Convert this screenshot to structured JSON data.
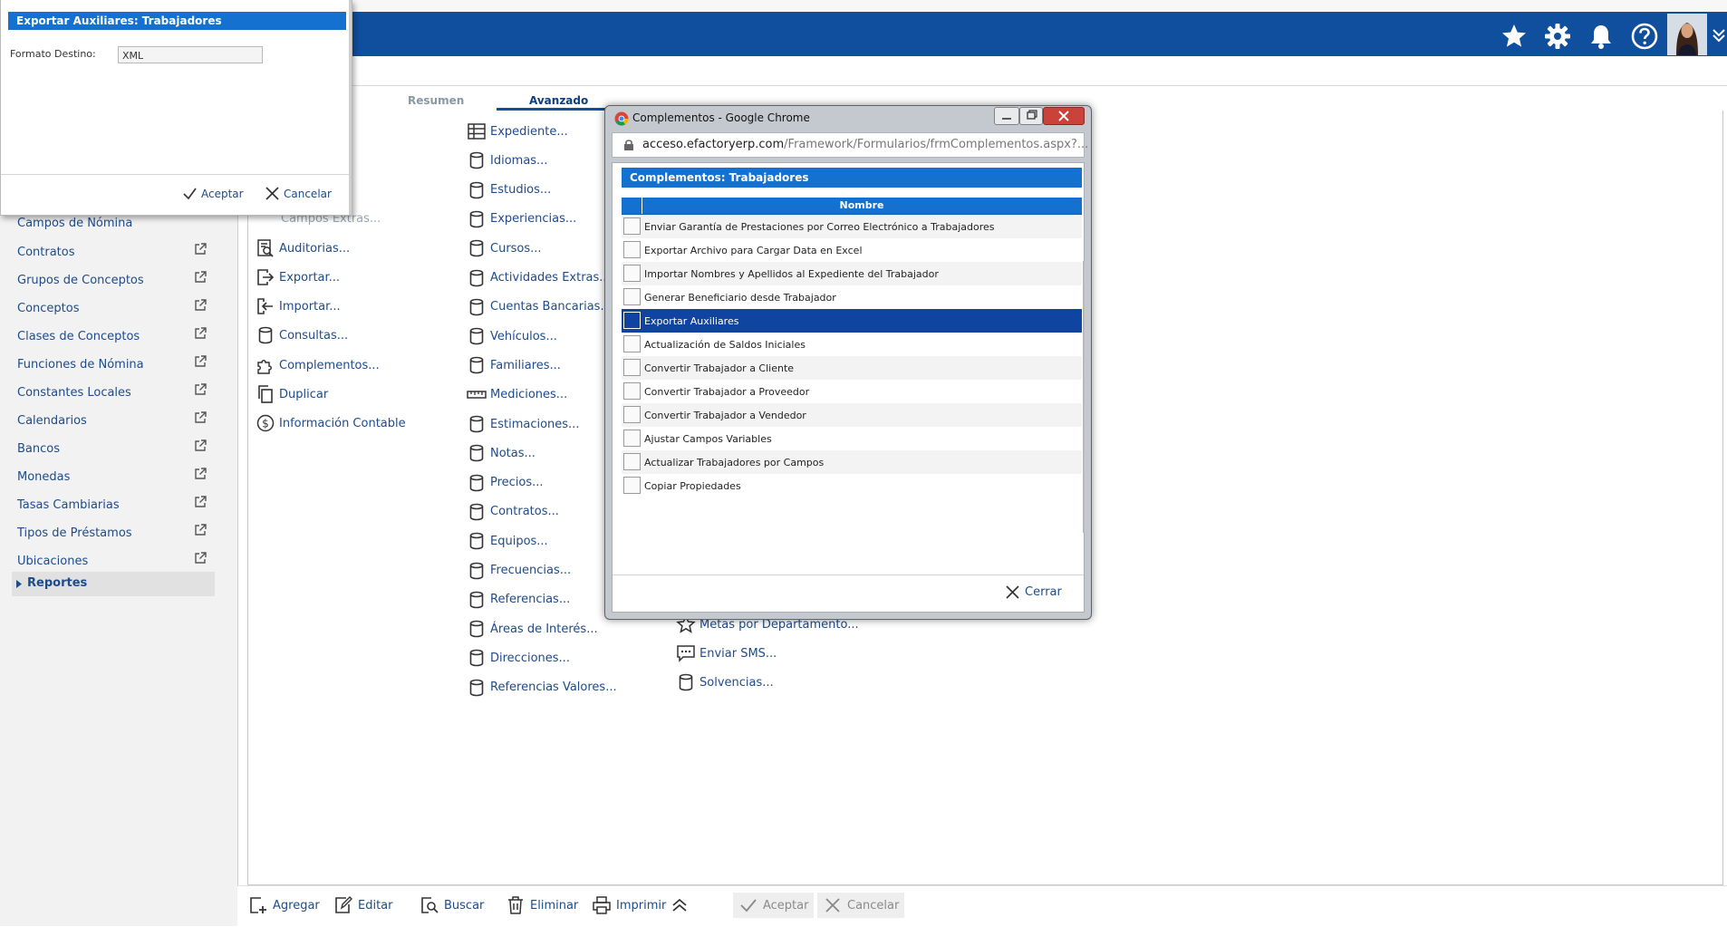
{
  "colors": {
    "header": "#0f4f9e",
    "accent": "#1571d0",
    "selected_row": "#0f44a0",
    "link": "#1e4b89"
  },
  "tabs": [
    {
      "label": "Resumen"
    },
    {
      "label": "Avanzado"
    }
  ],
  "sidebar": {
    "partial_item": "Campos de Nómina",
    "items": [
      {
        "label": "Contratos"
      },
      {
        "label": "Grupos de Conceptos"
      },
      {
        "label": "Conceptos"
      },
      {
        "label": "Clases de Conceptos"
      },
      {
        "label": "Funciones de Nómina"
      },
      {
        "label": "Constantes Locales"
      },
      {
        "label": "Calendarios"
      },
      {
        "label": "Bancos"
      },
      {
        "label": "Monedas"
      },
      {
        "label": "Tasas Cambiarias"
      },
      {
        "label": "Tipos de Préstamos"
      },
      {
        "label": "Ubicaciones"
      }
    ],
    "reports": "Reportes"
  },
  "menu_col1": {
    "partial_item": "Campos Extras...",
    "items": [
      {
        "label": "Auditorias...",
        "icon": "audit-icon"
      },
      {
        "label": "Exportar...",
        "icon": "export-icon"
      },
      {
        "label": "Importar...",
        "icon": "import-icon"
      },
      {
        "label": "Consultas...",
        "icon": "database-icon"
      },
      {
        "label": "Complementos...",
        "icon": "puzzle-icon"
      },
      {
        "label": "Duplicar",
        "icon": "copy-icon"
      },
      {
        "label": "Información Contable",
        "icon": "dollar-icon"
      }
    ]
  },
  "menu_col2": {
    "items": [
      {
        "label": "Expediente...",
        "icon": "grid-icon"
      },
      {
        "label": "Idiomas...",
        "icon": "database-icon"
      },
      {
        "label": "Estudios...",
        "icon": "database-icon"
      },
      {
        "label": "Experiencias...",
        "icon": "database-icon"
      },
      {
        "label": "Cursos...",
        "icon": "database-icon"
      },
      {
        "label": "Actividades Extras...",
        "icon": "database-icon"
      },
      {
        "label": "Cuentas Bancarias...",
        "icon": "database-icon"
      },
      {
        "label": "Vehículos...",
        "icon": "database-icon"
      },
      {
        "label": "Familiares...",
        "icon": "database-icon"
      },
      {
        "label": "Mediciones...",
        "icon": "ruler-icon"
      },
      {
        "label": "Estimaciones...",
        "icon": "database-icon"
      },
      {
        "label": "Notas...",
        "icon": "database-icon"
      },
      {
        "label": "Precios...",
        "icon": "database-icon"
      },
      {
        "label": "Contratos...",
        "icon": "database-icon"
      },
      {
        "label": "Equipos...",
        "icon": "database-icon"
      },
      {
        "label": "Frecuencias...",
        "icon": "database-icon"
      },
      {
        "label": "Referencias...",
        "icon": "database-icon"
      },
      {
        "label": "Áreas de Interés...",
        "icon": "database-icon"
      },
      {
        "label": "Direcciones...",
        "icon": "database-icon"
      },
      {
        "label": "Referencias Valores...",
        "icon": "database-icon"
      }
    ]
  },
  "menu_col3": {
    "items": [
      {
        "label": "Metas por Departamento...",
        "icon": "star-icon"
      },
      {
        "label": "Enviar SMS...",
        "icon": "sms-icon"
      },
      {
        "label": "Solvencias...",
        "icon": "database-icon"
      }
    ]
  },
  "bottom_toolbar": {
    "add": "Agregar",
    "edit": "Editar",
    "search": "Buscar",
    "delete": "Eliminar",
    "print": "Imprimir",
    "accept": "Aceptar",
    "cancel": "Cancelar"
  },
  "export_panel": {
    "title": "Exportar Auxiliares: Trabajadores",
    "format_label": "Formato Destino:",
    "format_value": "XML",
    "accept": "Aceptar",
    "cancel": "Cancelar"
  },
  "chrome_window": {
    "title": "Complementos - Google Chrome",
    "url_host": "acceso.efactoryerp.com",
    "url_path": "/Framework/Formularios/frmComplementos.aspx?...",
    "panel_title": "Complementos: Trabajadores",
    "column_header": "Nombre",
    "rows": [
      {
        "name": "Enviar Garantía de Prestaciones por Correo Electrónico a Trabajadores"
      },
      {
        "name": "Exportar Archivo para Cargar Data en Excel"
      },
      {
        "name": "Importar Nombres y Apellidos al Expediente del Trabajador"
      },
      {
        "name": "Generar Beneficiario desde Trabajador"
      },
      {
        "name": "Exportar Auxiliares",
        "selected": true
      },
      {
        "name": "Actualización de Saldos Iniciales"
      },
      {
        "name": "Convertir Trabajador a Cliente"
      },
      {
        "name": "Convertir Trabajador a Proveedor"
      },
      {
        "name": "Convertir Trabajador a Vendedor"
      },
      {
        "name": "Ajustar Campos Variables"
      },
      {
        "name": "Actualizar Trabajadores por Campos"
      },
      {
        "name": "Copiar Propiedades"
      }
    ],
    "close": "Cerrar"
  }
}
